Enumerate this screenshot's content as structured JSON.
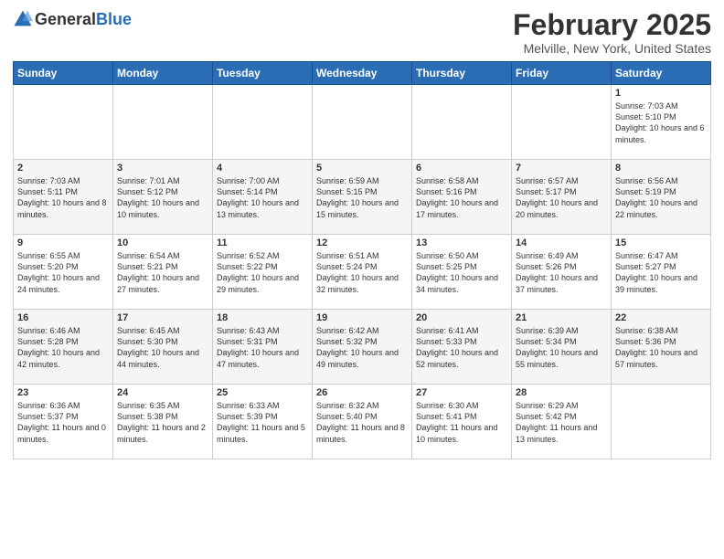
{
  "header": {
    "logo_general": "General",
    "logo_blue": "Blue",
    "title": "February 2025",
    "subtitle": "Melville, New York, United States"
  },
  "weekdays": [
    "Sunday",
    "Monday",
    "Tuesday",
    "Wednesday",
    "Thursday",
    "Friday",
    "Saturday"
  ],
  "weeks": [
    [
      {
        "day": "",
        "info": ""
      },
      {
        "day": "",
        "info": ""
      },
      {
        "day": "",
        "info": ""
      },
      {
        "day": "",
        "info": ""
      },
      {
        "day": "",
        "info": ""
      },
      {
        "day": "",
        "info": ""
      },
      {
        "day": "1",
        "info": "Sunrise: 7:03 AM\nSunset: 5:10 PM\nDaylight: 10 hours and 6 minutes."
      }
    ],
    [
      {
        "day": "2",
        "info": "Sunrise: 7:03 AM\nSunset: 5:11 PM\nDaylight: 10 hours and 8 minutes."
      },
      {
        "day": "3",
        "info": "Sunrise: 7:01 AM\nSunset: 5:12 PM\nDaylight: 10 hours and 10 minutes."
      },
      {
        "day": "4",
        "info": "Sunrise: 7:00 AM\nSunset: 5:14 PM\nDaylight: 10 hours and 13 minutes."
      },
      {
        "day": "5",
        "info": "Sunrise: 6:59 AM\nSunset: 5:15 PM\nDaylight: 10 hours and 15 minutes."
      },
      {
        "day": "6",
        "info": "Sunrise: 6:58 AM\nSunset: 5:16 PM\nDaylight: 10 hours and 17 minutes."
      },
      {
        "day": "7",
        "info": "Sunrise: 6:57 AM\nSunset: 5:17 PM\nDaylight: 10 hours and 20 minutes."
      },
      {
        "day": "8",
        "info": "Sunrise: 6:56 AM\nSunset: 5:19 PM\nDaylight: 10 hours and 22 minutes."
      }
    ],
    [
      {
        "day": "9",
        "info": "Sunrise: 6:55 AM\nSunset: 5:20 PM\nDaylight: 10 hours and 24 minutes."
      },
      {
        "day": "10",
        "info": "Sunrise: 6:54 AM\nSunset: 5:21 PM\nDaylight: 10 hours and 27 minutes."
      },
      {
        "day": "11",
        "info": "Sunrise: 6:52 AM\nSunset: 5:22 PM\nDaylight: 10 hours and 29 minutes."
      },
      {
        "day": "12",
        "info": "Sunrise: 6:51 AM\nSunset: 5:24 PM\nDaylight: 10 hours and 32 minutes."
      },
      {
        "day": "13",
        "info": "Sunrise: 6:50 AM\nSunset: 5:25 PM\nDaylight: 10 hours and 34 minutes."
      },
      {
        "day": "14",
        "info": "Sunrise: 6:49 AM\nSunset: 5:26 PM\nDaylight: 10 hours and 37 minutes."
      },
      {
        "day": "15",
        "info": "Sunrise: 6:47 AM\nSunset: 5:27 PM\nDaylight: 10 hours and 39 minutes."
      }
    ],
    [
      {
        "day": "16",
        "info": "Sunrise: 6:46 AM\nSunset: 5:28 PM\nDaylight: 10 hours and 42 minutes."
      },
      {
        "day": "17",
        "info": "Sunrise: 6:45 AM\nSunset: 5:30 PM\nDaylight: 10 hours and 44 minutes."
      },
      {
        "day": "18",
        "info": "Sunrise: 6:43 AM\nSunset: 5:31 PM\nDaylight: 10 hours and 47 minutes."
      },
      {
        "day": "19",
        "info": "Sunrise: 6:42 AM\nSunset: 5:32 PM\nDaylight: 10 hours and 49 minutes."
      },
      {
        "day": "20",
        "info": "Sunrise: 6:41 AM\nSunset: 5:33 PM\nDaylight: 10 hours and 52 minutes."
      },
      {
        "day": "21",
        "info": "Sunrise: 6:39 AM\nSunset: 5:34 PM\nDaylight: 10 hours and 55 minutes."
      },
      {
        "day": "22",
        "info": "Sunrise: 6:38 AM\nSunset: 5:36 PM\nDaylight: 10 hours and 57 minutes."
      }
    ],
    [
      {
        "day": "23",
        "info": "Sunrise: 6:36 AM\nSunset: 5:37 PM\nDaylight: 11 hours and 0 minutes."
      },
      {
        "day": "24",
        "info": "Sunrise: 6:35 AM\nSunset: 5:38 PM\nDaylight: 11 hours and 2 minutes."
      },
      {
        "day": "25",
        "info": "Sunrise: 6:33 AM\nSunset: 5:39 PM\nDaylight: 11 hours and 5 minutes."
      },
      {
        "day": "26",
        "info": "Sunrise: 6:32 AM\nSunset: 5:40 PM\nDaylight: 11 hours and 8 minutes."
      },
      {
        "day": "27",
        "info": "Sunrise: 6:30 AM\nSunset: 5:41 PM\nDaylight: 11 hours and 10 minutes."
      },
      {
        "day": "28",
        "info": "Sunrise: 6:29 AM\nSunset: 5:42 PM\nDaylight: 11 hours and 13 minutes."
      },
      {
        "day": "",
        "info": ""
      }
    ]
  ]
}
